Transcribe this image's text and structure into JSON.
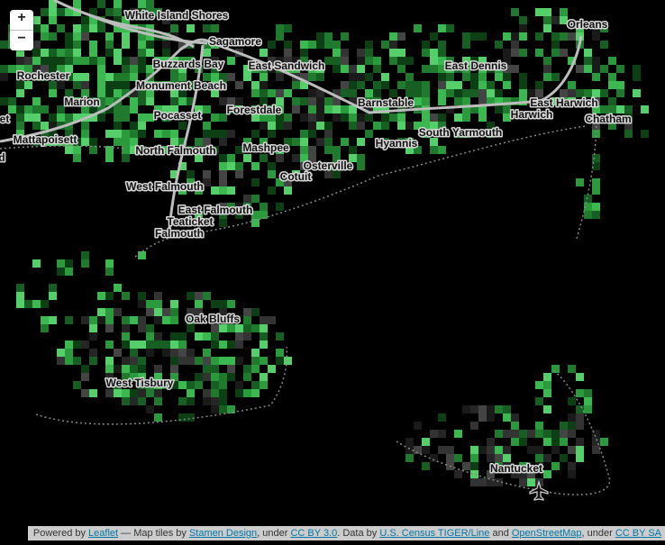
{
  "zoom": {
    "in_label": "+",
    "out_label": "−"
  },
  "places": [
    "White Island Shores",
    "Sagamore",
    "Buzzards Bay",
    "East Sandwich",
    "Rochester",
    "Monument Beach",
    "Marion",
    "Pocasset",
    "Forestdale",
    "Mattapoisett",
    "North Falmouth",
    "Mashpee",
    "Osterville",
    "Cotuit",
    "West Falmouth",
    "East Falmouth",
    "Teaticket",
    "Falmouth",
    "Orleans",
    "East Dennis",
    "Barnstable",
    "East Harwich",
    "Harwich",
    "Chatham",
    "South Yarmouth",
    "Hyannis",
    "Oak Bluffs",
    "West Tisbury",
    "Nantucket",
    "et",
    "d"
  ],
  "airport_icon": "airplane-icon",
  "attribution": {
    "powered_by": "Powered by",
    "leaflet": "Leaflet",
    "tiles_text": " — Map tiles by ",
    "stamen": "Stamen Design",
    "under1": ", under ",
    "cc_by_30": "CC BY 3.0",
    "data_by": ". Data by ",
    "tiger": "U.S. Census TIGER/Line",
    "and": " and ",
    "osm": "OpenStreetMap",
    "under2": ", under ",
    "cc_by_sa": "CC BY SA"
  },
  "colors": {
    "background": "#000000",
    "greens": [
      "#0c3f14",
      "#165e22",
      "#1f7a2e",
      "#2a9a3c",
      "#3bb850",
      "#54cf69"
    ],
    "grays": [
      "#1a1a1a",
      "#262626",
      "#333333",
      "#444444"
    ],
    "road": "#c9c9c9",
    "coast": "#8a8a8a"
  }
}
